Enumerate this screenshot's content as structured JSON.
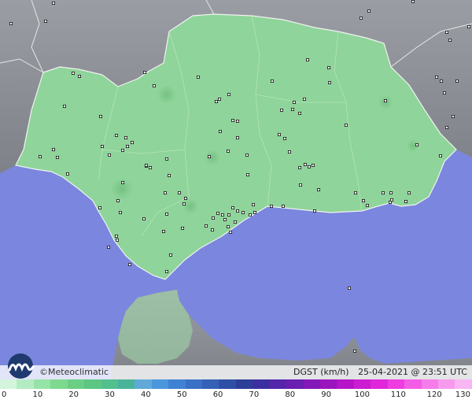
{
  "brand": {
    "name": "©Meteoclimatic",
    "logo": "meteoclimatic-logo-icon"
  },
  "status": {
    "variable": "DGST (km/h)",
    "timestamp": "25-04-2021 @ 23:51 UTC"
  },
  "legend": {
    "unit": "km/h",
    "labels": [
      "0",
      "10",
      "20",
      "30",
      "40",
      "50",
      "60",
      "70",
      "80",
      "90",
      "100",
      "110",
      "120",
      "130"
    ],
    "colors": [
      "#d2f5dc",
      "#b4ecc2",
      "#96e3a8",
      "#7dd98e",
      "#6acf84",
      "#5cc783",
      "#52bf8f",
      "#49b49a",
      "#60a9d8",
      "#4c96dc",
      "#3f82d4",
      "#3a70c6",
      "#3560b8",
      "#2f4fa6",
      "#2c3f98",
      "#3c2fa0",
      "#5426aa",
      "#6a1fb0",
      "#8418b8",
      "#9b14be",
      "#b514c8",
      "#cc1cd2",
      "#e026d8",
      "#ef3ce0",
      "#f35ce6",
      "#f57cea",
      "#f79aee",
      "#f8b6f2"
    ]
  },
  "map": {
    "sea_color": "#7b86de",
    "land_color": "#888c92",
    "region_color": "#8fd49a",
    "station_count": 120
  }
}
